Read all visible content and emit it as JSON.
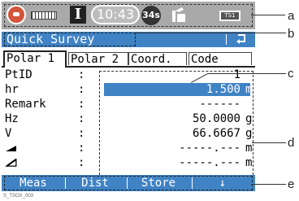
{
  "status_bar": {
    "icons": [
      "satellite-globe-icon",
      "prism-icon",
      "edm-mode-icon",
      "clock-icon",
      "point-id-counter-icon",
      "compensator-icon",
      "battery-icon"
    ],
    "edm_letter": "I",
    "time": "10:43",
    "counter": "34s",
    "battery_label": "TS1"
  },
  "title_bar": {
    "title": "Quick Survey",
    "back_glyph": "↺"
  },
  "tabs": [
    {
      "label": "Polar 1",
      "active": true
    },
    {
      "label": "Polar 2",
      "active": false
    },
    {
      "label": "Coord.",
      "active": false
    },
    {
      "label": "Code",
      "active": false
    }
  ],
  "fields": [
    {
      "label": "PtID",
      "value": "1",
      "unit": ""
    },
    {
      "label": "hr",
      "value": "1.500",
      "unit": "m",
      "selected": true
    },
    {
      "label": "Remark",
      "value": "------",
      "unit": ""
    },
    {
      "label": "Hz",
      "value": "50.0000",
      "unit": "g"
    },
    {
      "label": "V",
      "value": "66.6667",
      "unit": "g"
    },
    {
      "label": "horizontal-distance-symbol",
      "value": "-----.---",
      "unit": "m"
    },
    {
      "label": "slope-distance-symbol",
      "value": "-----.---",
      "unit": "m"
    }
  ],
  "softkeys": [
    "Meas",
    "Dist",
    "Store",
    "↓"
  ],
  "figure_id": "S_TSOX_003",
  "callouts": [
    "a",
    "b",
    "c",
    "d",
    "e"
  ],
  "colors": {
    "accent": "#3f83c5",
    "status_bar_bg": "#a9a9a9",
    "satellite_icon": "#d3553c"
  }
}
